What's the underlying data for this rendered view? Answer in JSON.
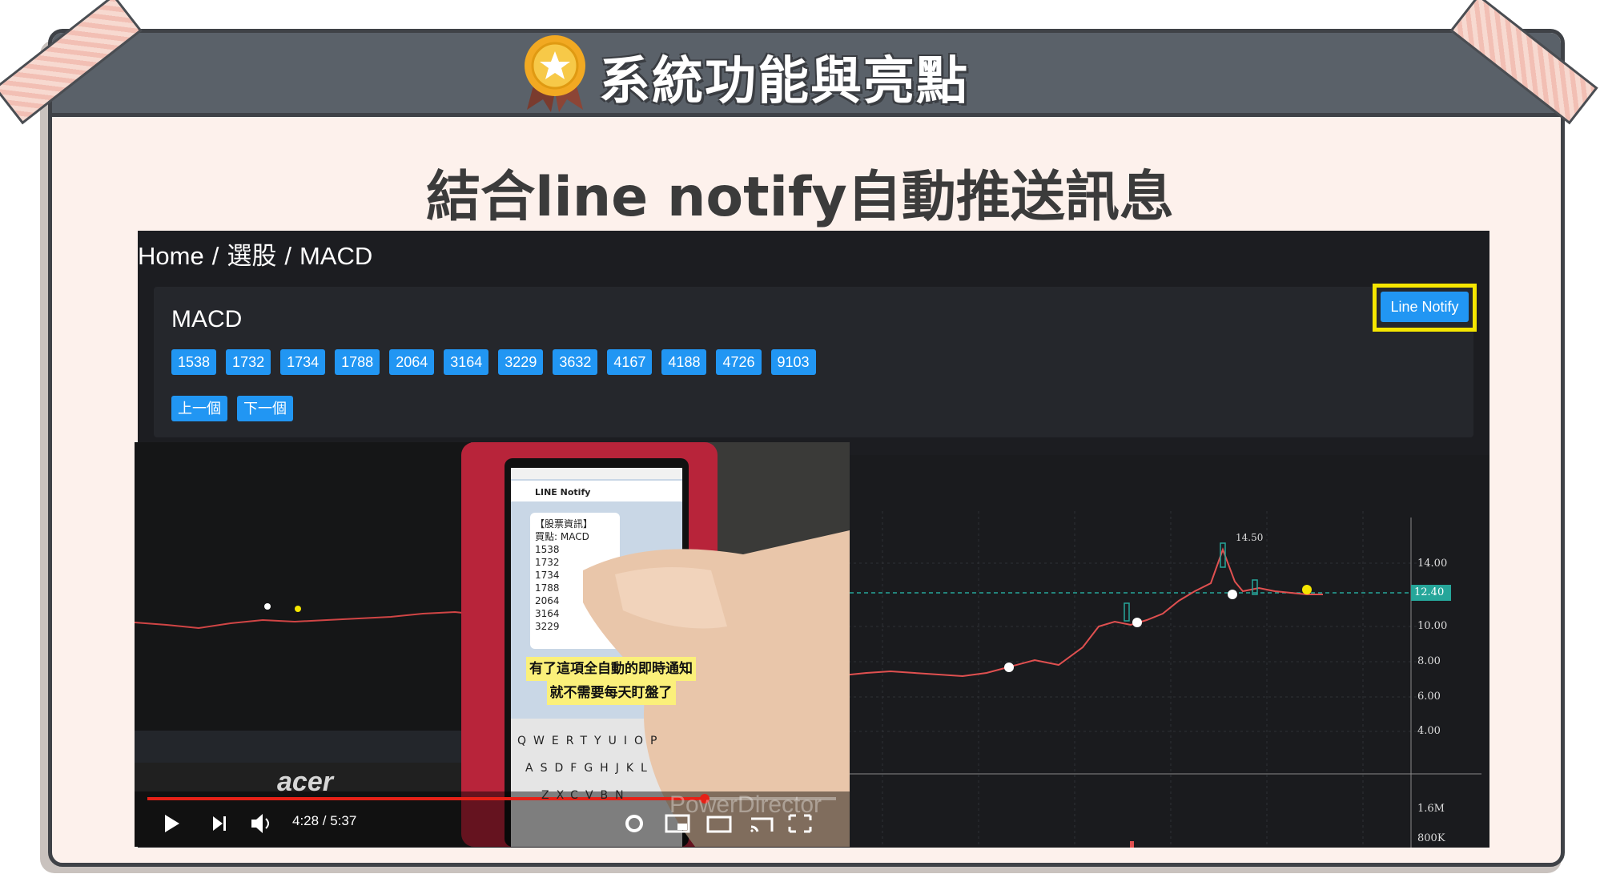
{
  "header": {
    "title": "系統功能與亮點",
    "subtitle": "結合line notify自動推送訊息"
  },
  "app": {
    "breadcrumb": [
      "Home",
      "/",
      "選股",
      "/",
      "MACD"
    ],
    "card_title": "MACD",
    "stock_codes": [
      "1538",
      "1732",
      "1734",
      "1788",
      "2064",
      "3164",
      "3229",
      "3632",
      "4167",
      "4188",
      "4726",
      "9103"
    ],
    "prev_label": "上一個",
    "next_label": "下一個",
    "line_notify_label": "Line Notify"
  },
  "chart": {
    "price_ticks": [
      "14.00",
      "10.00",
      "8.00",
      "6.00",
      "4.00"
    ],
    "current_price": "12.40",
    "high_label": "14.50",
    "volume_ticks": [
      "1.6M",
      "800K"
    ]
  },
  "video": {
    "time_display": "4:28 / 5:37",
    "watermark": "PowerDirector",
    "laptop_brand": "acer",
    "caption_lines": [
      "有了這項全自動的即時通知",
      "就不需要每天盯盤了"
    ],
    "phone": {
      "app_title": "LINE Notify",
      "message_lines": [
        "【股票資訊】",
        "買點: MACD",
        "1538",
        "1732",
        "1734",
        "1788",
        "2064",
        "3164",
        "3229"
      ],
      "keyboard_row1": [
        "Q",
        "W",
        "E",
        "R",
        "T",
        "Y",
        "U",
        "I",
        "O",
        "P"
      ],
      "keyboard_row2": [
        "A",
        "S",
        "D",
        "F",
        "G",
        "H",
        "J",
        "K",
        "L"
      ],
      "keyboard_row3": [
        "Z",
        "X",
        "C",
        "V",
        "B",
        "N"
      ]
    }
  },
  "colors": {
    "accent": "#2196f3",
    "highlight": "#f5e600",
    "header_bg": "#5a6169",
    "board_bg": "#fdf1ec"
  }
}
